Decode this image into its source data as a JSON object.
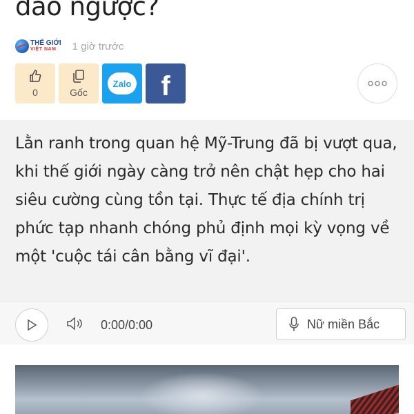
{
  "article": {
    "title_line": "đảo ngược?",
    "source": {
      "logo_top": "THẾ GIỚI",
      "logo_bottom": "VIỆT NAM",
      "time": "1 giờ trước"
    },
    "actions": {
      "like_count": "0",
      "source_label": "Gốc",
      "zalo_label": "Zalo",
      "facebook_label": "f"
    },
    "summary": "Lằn ranh trong quan hệ Mỹ-Trung đã bị vượt qua, khi thế giới ngày càng trở nên chật hẹp cho hai siêu cường cùng tồn tại. Thực tế địa chính trị phức tạp nhanh chóng phủ định mọi kỳ vọng về một 'cuộc tái cân bằng vĩ đại'.",
    "player": {
      "time": "0:00/0:00",
      "voice": "Nữ miền Bắc"
    }
  },
  "icons": {
    "like": "thumbs-up-icon",
    "source": "copy-icon",
    "more": "more-dots-icon",
    "play": "play-icon",
    "volume": "volume-icon",
    "mic": "microphone-icon"
  },
  "colors": {
    "action_bg": "#fbe9c9",
    "zalo": "#1aa2ef",
    "facebook": "#3b5897",
    "summary_bg": "#f2f2f2"
  }
}
